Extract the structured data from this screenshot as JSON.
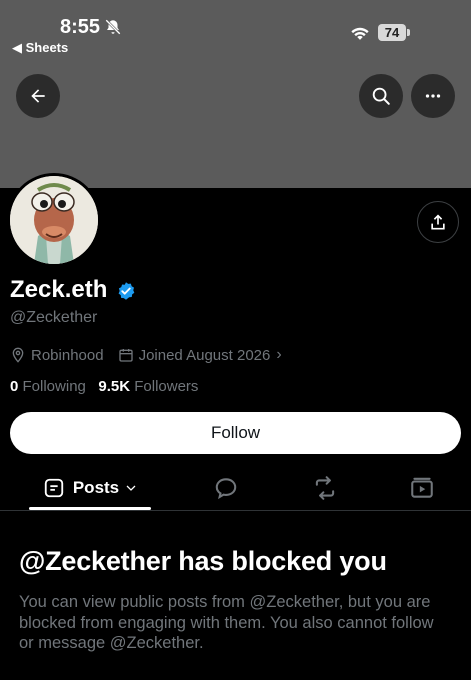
{
  "status_bar": {
    "time": "8:55",
    "back_app": "◀ Sheets",
    "battery": "74"
  },
  "icons": {
    "back": "arrow-left-icon",
    "search": "search-icon",
    "more": "more-icon",
    "share": "share-icon",
    "verified": "verified-badge-icon",
    "location": "location-pin-icon",
    "calendar": "calendar-icon"
  },
  "profile": {
    "display_name": "Zeck.eth",
    "handle": "@Zeckether",
    "location": "Robinhood",
    "joined": "Joined August 2026",
    "following_count": "0",
    "following_label": " Following",
    "followers_count": "9.5K",
    "followers_label": " Followers",
    "follow_label": "Follow"
  },
  "tabs": {
    "posts_label": "Posts"
  },
  "blocked": {
    "title": "@Zeckether has blocked you",
    "description": "You can view public posts from @Zeckether, but you are blocked from engaging with them. You also cannot follow or message @Zeckether."
  },
  "colors": {
    "banner": "#5b5b5b",
    "background": "#000000",
    "secondary_text": "#71767b",
    "verified": "#1d9bf0"
  }
}
